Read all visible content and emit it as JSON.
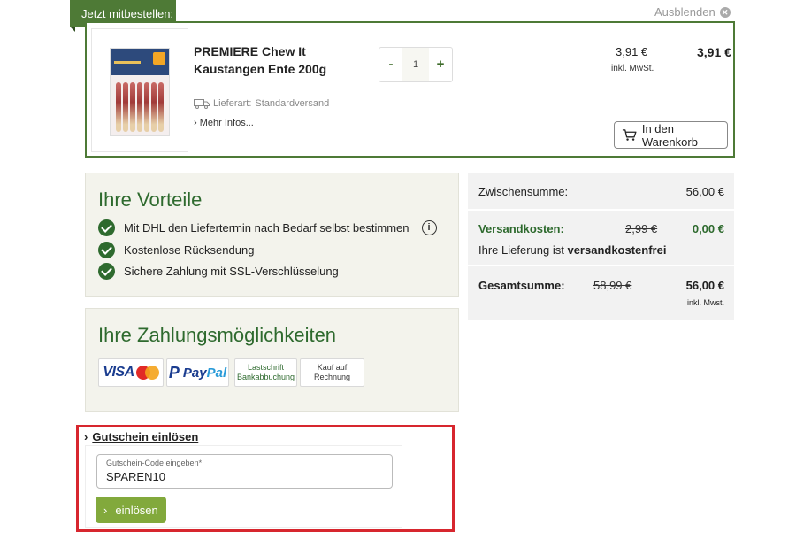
{
  "upsell": {
    "tab_label": "Jetzt mitbestellen:",
    "hide_label": "Ausblenden",
    "product": {
      "title": "PREMIERE Chew It Kaustangen Ente 200g",
      "quantity": "1",
      "qty_minus": "-",
      "qty_plus": "+",
      "delivery_label": "Lieferart:",
      "delivery_value": "Standardversand",
      "more_info": "Mehr Infos...",
      "unit_price": "3,91 €",
      "unit_tax_note": "inkl. MwSt.",
      "line_price": "3,91 €",
      "add_to_cart": "In den Warenkorb"
    }
  },
  "benefits": {
    "title": "Ihre Vorteile",
    "items": [
      "Mit DHL den Liefertermin nach Bedarf selbst bestimmen",
      "Kostenlose Rücksendung",
      "Sichere Zahlung mit SSL-Verschlüsselung"
    ],
    "info_glyph": "i"
  },
  "payment": {
    "title": "Ihre Zahlungsmöglichkeiten",
    "methods": {
      "visa": "VISA",
      "paypal_pay": "Pay",
      "paypal_pal": "Pal",
      "paypal_icon": "P",
      "lastschrift_line1": "Lastschrift",
      "lastschrift_line2": "Bankabbuchung",
      "rechnung_line1": "Kauf auf",
      "rechnung_line2": "Rechnung"
    }
  },
  "coupon": {
    "toggle_label": "Gutschein einlösen",
    "field_label": "Gutschein-Code eingeben*",
    "field_value": "SPAREN10",
    "redeem_label": "einlösen"
  },
  "summary": {
    "subtotal_label": "Zwischensumme:",
    "subtotal_value": "56,00 €",
    "shipping_label": "Versandkosten:",
    "shipping_old": "2,99 €",
    "shipping_value": "0,00 €",
    "shipping_note_prefix": "Ihre Lieferung ist",
    "shipping_note_bold": "versandkostenfrei",
    "total_label": "Gesamtsumme:",
    "total_old": "58,99 €",
    "total_value": "56,00 €",
    "total_tax_note": "inkl. Mwst."
  },
  "colors": {
    "brand_green": "#2e6a2e",
    "tab_green": "#4e7a36",
    "button_green": "#82a93c",
    "highlight_red": "#d7262e"
  }
}
